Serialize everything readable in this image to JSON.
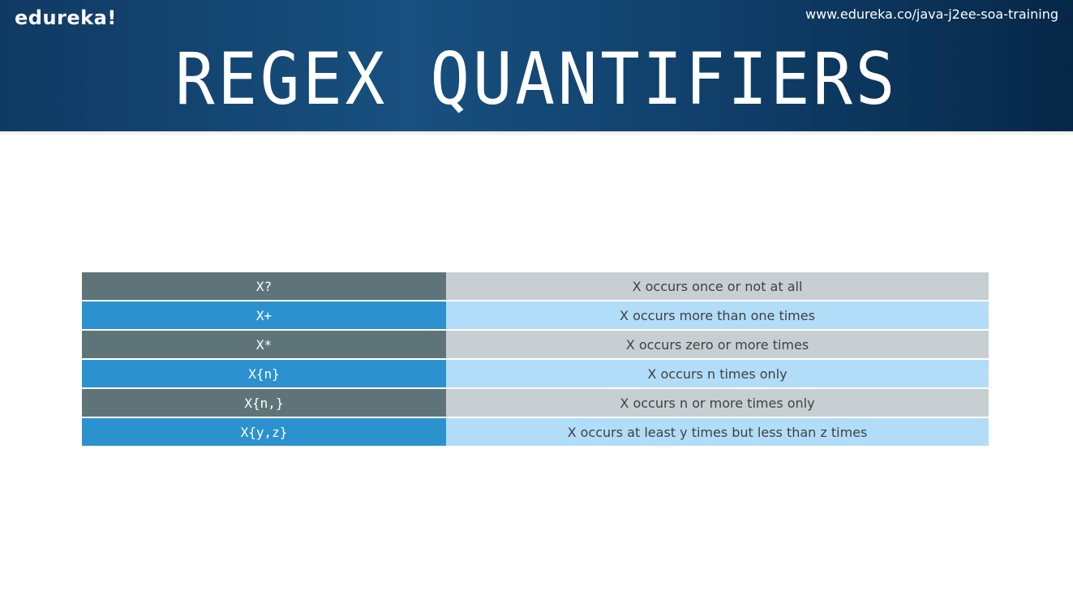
{
  "header": {
    "brand": "edureka!",
    "url": "www.edureka.co/java-j2ee-soa-training",
    "title": "REGEX QUANTIFIERS"
  },
  "table": {
    "rows": [
      {
        "quantifier": "X?",
        "meaning": "X occurs once or not at all",
        "style": "dark"
      },
      {
        "quantifier": "X+",
        "meaning": "X occurs more than one times",
        "style": "blue"
      },
      {
        "quantifier": "X*",
        "meaning": "X occurs zero or more times",
        "style": "dark"
      },
      {
        "quantifier": "X{n}",
        "meaning": "X occurs n times only",
        "style": "blue"
      },
      {
        "quantifier": "X{n,}",
        "meaning": "X occurs n or more times only",
        "style": "dark"
      },
      {
        "quantifier": "X{y,z}",
        "meaning": "X occurs at least y times but less than z times",
        "style": "blue"
      }
    ]
  },
  "colors": {
    "banner": "#0f3d67",
    "dark_left": "#5f7479",
    "dark_right": "#c8cfd2",
    "blue_left": "#2b92cf",
    "blue_right": "#b2ddf8"
  }
}
